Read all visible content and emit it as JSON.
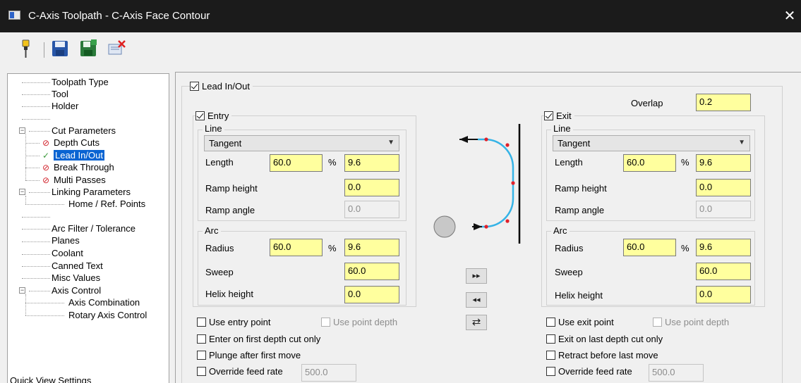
{
  "window": {
    "title": "C-Axis Toolpath - C-Axis Face Contour",
    "close_glyph": "✕"
  },
  "toolbar": {
    "icons": [
      "pin-icon",
      "save-icon",
      "save-as-icon",
      "delete-icon"
    ]
  },
  "tree": {
    "items": [
      {
        "label": "Toolpath Type"
      },
      {
        "label": "Tool"
      },
      {
        "label": "Holder"
      },
      {
        "label": "Cut Parameters",
        "expander": "−"
      },
      {
        "label": "Depth Cuts",
        "icon": "disabled-icon"
      },
      {
        "label": "Lead In/Out",
        "icon": "check-icon",
        "selected": true
      },
      {
        "label": "Break Through",
        "icon": "disabled-icon"
      },
      {
        "label": "Multi Passes",
        "icon": "disabled-icon"
      },
      {
        "label": "Linking Parameters",
        "expander": "−"
      },
      {
        "label": "Home / Ref. Points"
      },
      {
        "label": "Arc Filter / Tolerance"
      },
      {
        "label": "Planes"
      },
      {
        "label": "Coolant"
      },
      {
        "label": "Canned Text"
      },
      {
        "label": "Misc Values"
      },
      {
        "label": "Axis Control",
        "expander": "−"
      },
      {
        "label": "Axis Combination"
      },
      {
        "label": "Rotary Axis Control"
      }
    ],
    "quick_view": "Quick View Settings"
  },
  "leadinout": {
    "label": "Lead In/Out",
    "checked": true,
    "overlap_label": "Overlap",
    "overlap_value": "0.2",
    "entry": {
      "label": "Entry",
      "checked": true,
      "line_label": "Line",
      "line_type": "Tangent",
      "length_label": "Length",
      "length_value": "60.0",
      "percent": "%",
      "length_pct": "9.6",
      "ramp_height_label": "Ramp height",
      "ramp_height_value": "0.0",
      "ramp_angle_label": "Ramp angle",
      "ramp_angle_value": "0.0",
      "arc_label": "Arc",
      "radius_label": "Radius",
      "radius_value": "60.0",
      "radius_pct": "9.6",
      "sweep_label": "Sweep",
      "sweep_value": "60.0",
      "helix_label": "Helix height",
      "helix_value": "0.0",
      "use_point_label": "Use entry point",
      "use_point_depth_label": "Use point depth",
      "depth_cut_label": "Enter on first depth cut only",
      "move_label": "Plunge after first move",
      "override_label": "Override feed rate",
      "override_value": "500.0"
    },
    "exit": {
      "label": "Exit",
      "checked": true,
      "line_label": "Line",
      "line_type": "Tangent",
      "length_label": "Length",
      "length_value": "60.0",
      "percent": "%",
      "length_pct": "9.6",
      "ramp_height_label": "Ramp height",
      "ramp_height_value": "0.0",
      "ramp_angle_label": "Ramp angle",
      "ramp_angle_value": "0.0",
      "arc_label": "Arc",
      "radius_label": "Radius",
      "radius_value": "60.0",
      "radius_pct": "9.6",
      "sweep_label": "Sweep",
      "sweep_value": "60.0",
      "helix_label": "Helix height",
      "helix_value": "0.0",
      "use_point_label": "Use exit point",
      "use_point_depth_label": "Use point depth",
      "depth_cut_label": "Exit on last depth cut only",
      "move_label": "Retract before last move",
      "override_label": "Override feed rate",
      "override_value": "500.0"
    },
    "copy_buttons": {
      "to_exit": "▸▸",
      "to_entry": "◂◂",
      "swap": "⇄"
    }
  },
  "colors": {
    "field_yellow": "#ffff9e",
    "selection_blue": "#0a64d2",
    "preview_arc": "#35b3e6"
  }
}
